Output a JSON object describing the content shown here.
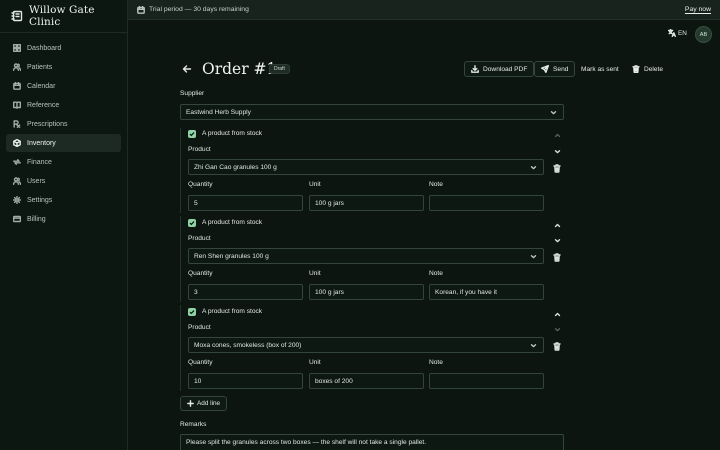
{
  "app": {
    "name": "Willow Gate Clinic"
  },
  "sidebar": {
    "items": [
      {
        "label": "Dashboard",
        "icon": "dashboard-icon",
        "active": false
      },
      {
        "label": "Patients",
        "icon": "users-icon",
        "active": false
      },
      {
        "label": "Calendar",
        "icon": "calendar-icon",
        "active": false
      },
      {
        "label": "Reference",
        "icon": "book-icon",
        "active": false
      },
      {
        "label": "Prescriptions",
        "icon": "prescription-icon",
        "active": false
      },
      {
        "label": "Inventory",
        "icon": "box-icon",
        "active": true
      },
      {
        "label": "Finance",
        "icon": "finance-icon",
        "active": false
      },
      {
        "label": "Users",
        "icon": "users-icon",
        "active": false
      },
      {
        "label": "Settings",
        "icon": "gear-icon",
        "active": false
      },
      {
        "label": "Billing",
        "icon": "card-icon",
        "active": false
      }
    ]
  },
  "trial": {
    "text": "Trial period — 30 days remaining",
    "action": "Pay now"
  },
  "header": {
    "language": "EN",
    "avatar_initials": "AB"
  },
  "order": {
    "title": "Order #1",
    "status": "Draft",
    "actions": {
      "download": "Download PDF",
      "send": "Send",
      "mark_sent": "Mark as sent",
      "delete": "Delete"
    }
  },
  "form": {
    "supplier_label": "Supplier",
    "supplier_value": "Eastwind Herb Supply",
    "lines": [
      {
        "from_stock_label": "A product from stock",
        "product_label": "Product",
        "product": "Zhi Gan Cao granules 100 g",
        "quantity_label": "Quantity",
        "quantity": "5",
        "unit_label": "Unit",
        "unit": "100 g jars",
        "note_label": "Note",
        "note": ""
      },
      {
        "from_stock_label": "A product from stock",
        "product_label": "Product",
        "product": "Ren Shen granules 100 g",
        "quantity_label": "Quantity",
        "quantity": "3",
        "unit_label": "Unit",
        "unit": "100 g jars",
        "note_label": "Note",
        "note": "Korean, if you have it"
      },
      {
        "from_stock_label": "A product from stock",
        "product_label": "Product",
        "product": "Moxa cones, smokeless (box of 200)",
        "quantity_label": "Quantity",
        "quantity": "10",
        "unit_label": "Unit",
        "unit": "boxes of 200",
        "note_label": "Note",
        "note": ""
      }
    ],
    "add_line": "Add line",
    "remarks_label": "Remarks",
    "remarks": "Please split the granules across two boxes — the shelf will not take a single pallet."
  },
  "colors": {
    "accent": "#8fd3a5",
    "background": "#0c1510",
    "sidebar_active": "#1d2a23"
  }
}
